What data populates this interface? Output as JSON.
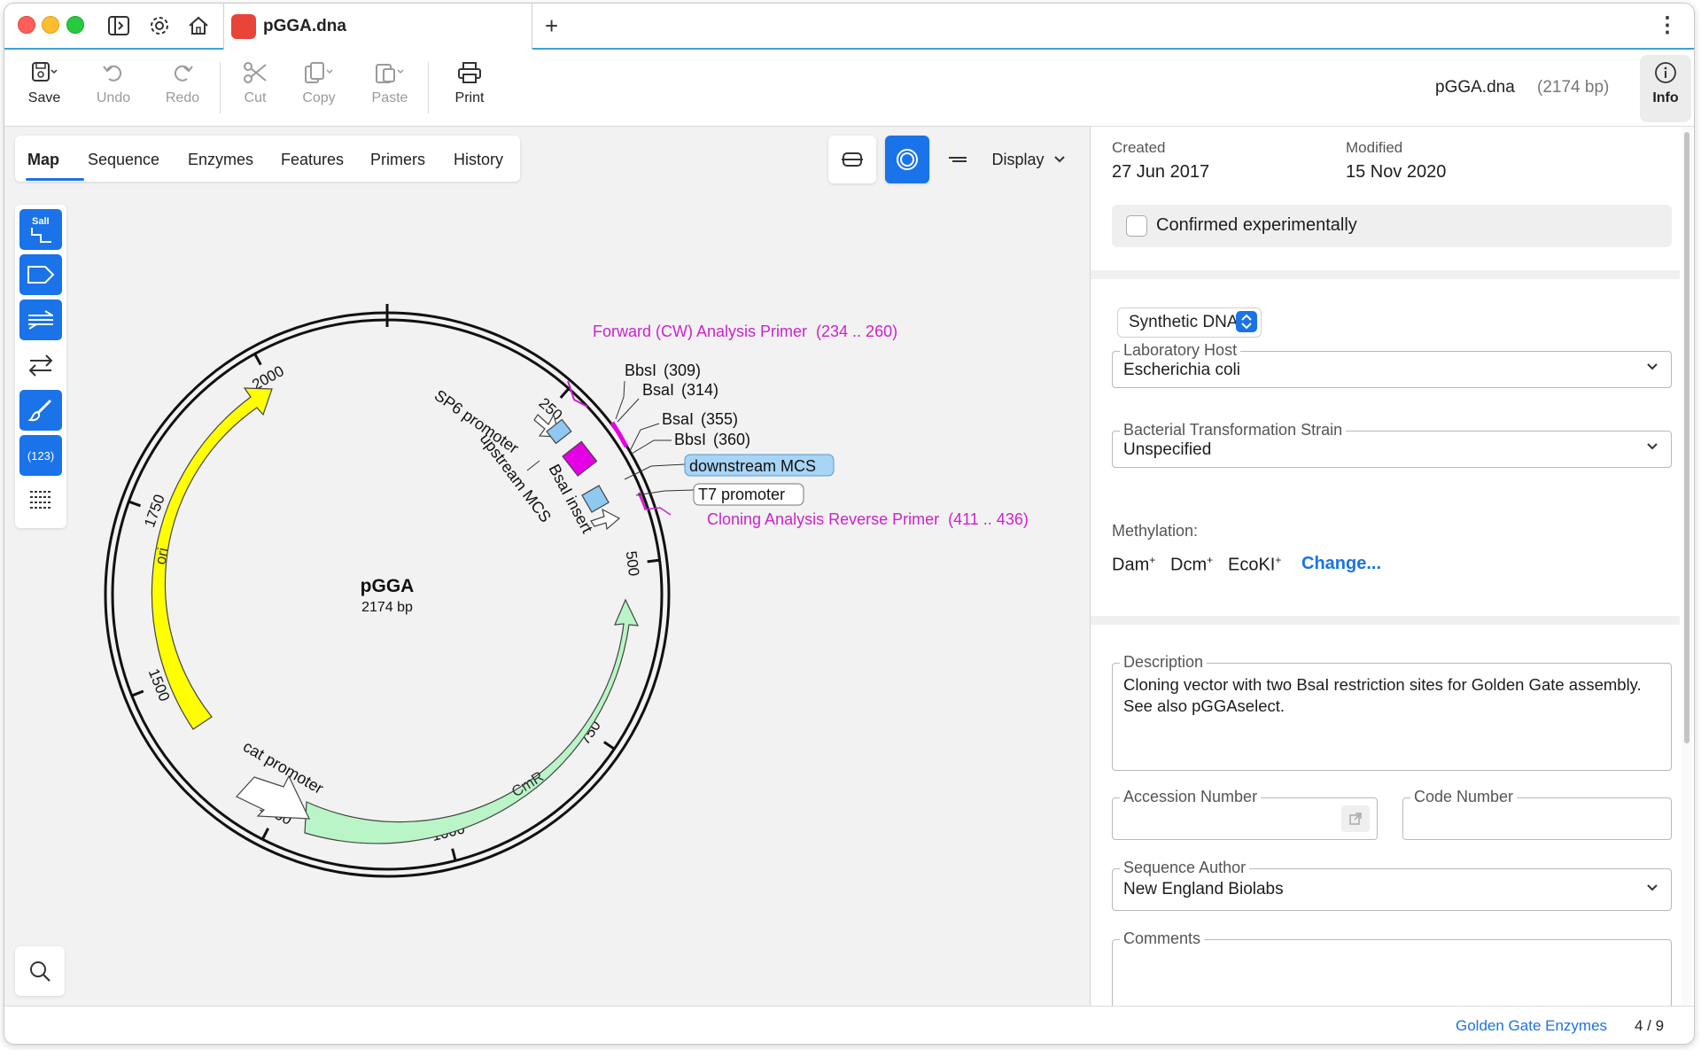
{
  "titlebar": {
    "tab_title": "pGGA.dna",
    "new_tab_label": "+",
    "more_label": "⋮"
  },
  "toolbar": {
    "save": "Save",
    "undo": "Undo",
    "redo": "Redo",
    "cut": "Cut",
    "copy": "Copy",
    "paste": "Paste",
    "print": "Print",
    "doc_name": "pGGA.dna",
    "doc_length": "(2174 bp)",
    "info": "Info"
  },
  "view_tabs": [
    "Map",
    "Sequence",
    "Enzymes",
    "Features",
    "Primers",
    "History"
  ],
  "display_menu": "Display",
  "side_tools": {
    "sali_label": "SalI",
    "numbers_label": "(123)"
  },
  "map": {
    "name": "pGGA",
    "length": "2174 bp",
    "ticks": [
      "250",
      "500",
      "750",
      "1000",
      "1250",
      "1500",
      "1750",
      "2000"
    ],
    "features": {
      "ori": "ori",
      "cmr": "CmR",
      "cat_promoter": "cat promoter",
      "sp6": "SP6 promoter",
      "upstream": "upstream MCS",
      "bsai_insert": "BsaI insert"
    },
    "enzymes": [
      {
        "name": "BbsI",
        "pos": "(309)"
      },
      {
        "name": "BsaI",
        "pos": "(314)"
      },
      {
        "name": "BsaI",
        "pos": "(355)"
      },
      {
        "name": "BbsI",
        "pos": "(360)"
      }
    ],
    "callouts": {
      "downstream": "downstream MCS",
      "t7": "T7 promoter"
    },
    "primers": {
      "forward": "Forward (CW) Analysis Primer",
      "forward_range": "(234 .. 260)",
      "reverse": "Cloning Analysis Reverse Primer",
      "reverse_range": "(411 .. 436)"
    },
    "colors": {
      "ori": "#ffff00",
      "cmr": "#b9f5c6",
      "primer": "#cc22cc",
      "insert": "#e600e6",
      "mcs": "#8fc8f0"
    }
  },
  "info": {
    "created_label": "Created",
    "created_value": "27 Jun 2017",
    "modified_label": "Modified",
    "modified_value": "15 Nov 2020",
    "confirmed_label": "Confirmed experimentally",
    "molecule_type": "Synthetic DNA",
    "lab_host_label": "Laboratory Host",
    "lab_host_value": "Escherichia coli",
    "strain_label": "Bacterial Transformation Strain",
    "strain_value": "Unspecified",
    "methylation_label": "Methylation:",
    "methylation": [
      {
        "name": "Dam",
        "sup": "+"
      },
      {
        "name": "Dcm",
        "sup": "+"
      },
      {
        "name": "EcoKI",
        "sup": "+"
      }
    ],
    "change_label": "Change...",
    "description_label": "Description",
    "description_value": "Cloning vector with two BsaI restriction sites for Golden Gate assembly. See also pGGAselect.",
    "accession_label": "Accession Number",
    "accession_value": "",
    "code_label": "Code Number",
    "code_value": "",
    "author_label": "Sequence Author",
    "author_value": "New England Biolabs",
    "comments_label": "Comments"
  },
  "status": {
    "collection": "Golden Gate Enzymes",
    "position": "4 / 9"
  }
}
